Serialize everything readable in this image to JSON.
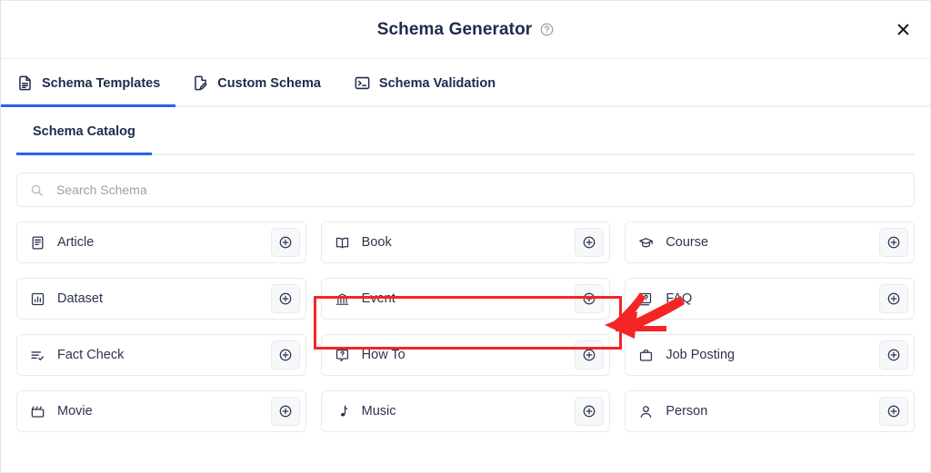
{
  "header": {
    "title": "Schema Generator",
    "help_icon": "help-circle-icon",
    "close_icon": "close-icon"
  },
  "tabs": [
    {
      "label": "Schema Templates",
      "icon": "file-text-icon",
      "active": true
    },
    {
      "label": "Custom Schema",
      "icon": "file-edit-icon",
      "active": false
    },
    {
      "label": "Schema Validation",
      "icon": "terminal-icon",
      "active": false
    }
  ],
  "subtabs": [
    {
      "label": "Schema Catalog",
      "active": true
    }
  ],
  "search": {
    "placeholder": "Search Schema",
    "value": "",
    "icon": "search-icon"
  },
  "catalog": {
    "add_icon": "plus-circle-icon",
    "items": [
      {
        "label": "Article",
        "icon": "article-icon",
        "highlighted": false
      },
      {
        "label": "Book",
        "icon": "book-icon",
        "highlighted": false
      },
      {
        "label": "Course",
        "icon": "graduation-cap-icon",
        "highlighted": false
      },
      {
        "label": "Dataset",
        "icon": "chart-square-icon",
        "highlighted": false
      },
      {
        "label": "Event",
        "icon": "landmark-icon",
        "highlighted": true
      },
      {
        "label": "FAQ",
        "icon": "faq-icon",
        "highlighted": false
      },
      {
        "label": "Fact Check",
        "icon": "list-check-icon",
        "highlighted": false
      },
      {
        "label": "How To",
        "icon": "help-square-icon",
        "highlighted": false
      },
      {
        "label": "Job Posting",
        "icon": "briefcase-icon",
        "highlighted": false
      },
      {
        "label": "Movie",
        "icon": "clapperboard-icon",
        "highlighted": false
      },
      {
        "label": "Music",
        "icon": "music-note-icon",
        "highlighted": false
      },
      {
        "label": "Person",
        "icon": "person-icon",
        "highlighted": false
      }
    ]
  },
  "annotation": {
    "color": "#f42525",
    "highlight_target": "Event",
    "arrow_target": "add-button-event"
  }
}
